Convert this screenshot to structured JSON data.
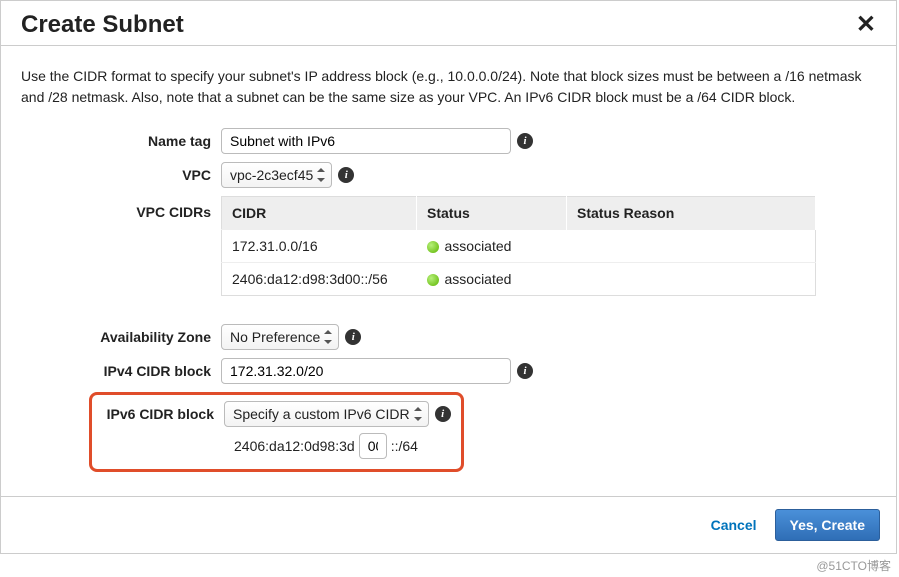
{
  "dialog": {
    "title": "Create Subnet"
  },
  "intro": "Use the CIDR format to specify your subnet's IP address block (e.g., 10.0.0.0/24). Note that block sizes must be between a /16 netmask and /28 netmask. Also, note that a subnet can be the same size as your VPC. An IPv6 CIDR block must be a /64 CIDR block.",
  "labels": {
    "name_tag": "Name tag",
    "vpc": "VPC",
    "vpc_cidrs": "VPC CIDRs",
    "az": "Availability Zone",
    "ipv4": "IPv4 CIDR block",
    "ipv6": "IPv6 CIDR block"
  },
  "fields": {
    "name_tag": "Subnet with IPv6",
    "vpc_selected": "vpc-2c3ecf45",
    "az_selected": "No Preference",
    "ipv4_value": "172.31.32.0/20",
    "ipv6_mode": "Specify a custom IPv6 CIDR",
    "ipv6_prefix_left": "2406:da12:0d98:3d",
    "ipv6_subnet_hex": "00",
    "ipv6_suffix": "::/64"
  },
  "cidr_table": {
    "headers": {
      "cidr": "CIDR",
      "status": "Status",
      "reason": "Status Reason"
    },
    "rows": [
      {
        "cidr": "172.31.0.0/16",
        "status": "associated",
        "reason": ""
      },
      {
        "cidr": "2406:da12:d98:3d00::/56",
        "status": "associated",
        "reason": ""
      }
    ]
  },
  "buttons": {
    "cancel": "Cancel",
    "create": "Yes, Create"
  },
  "watermark": "@51CTO博客"
}
